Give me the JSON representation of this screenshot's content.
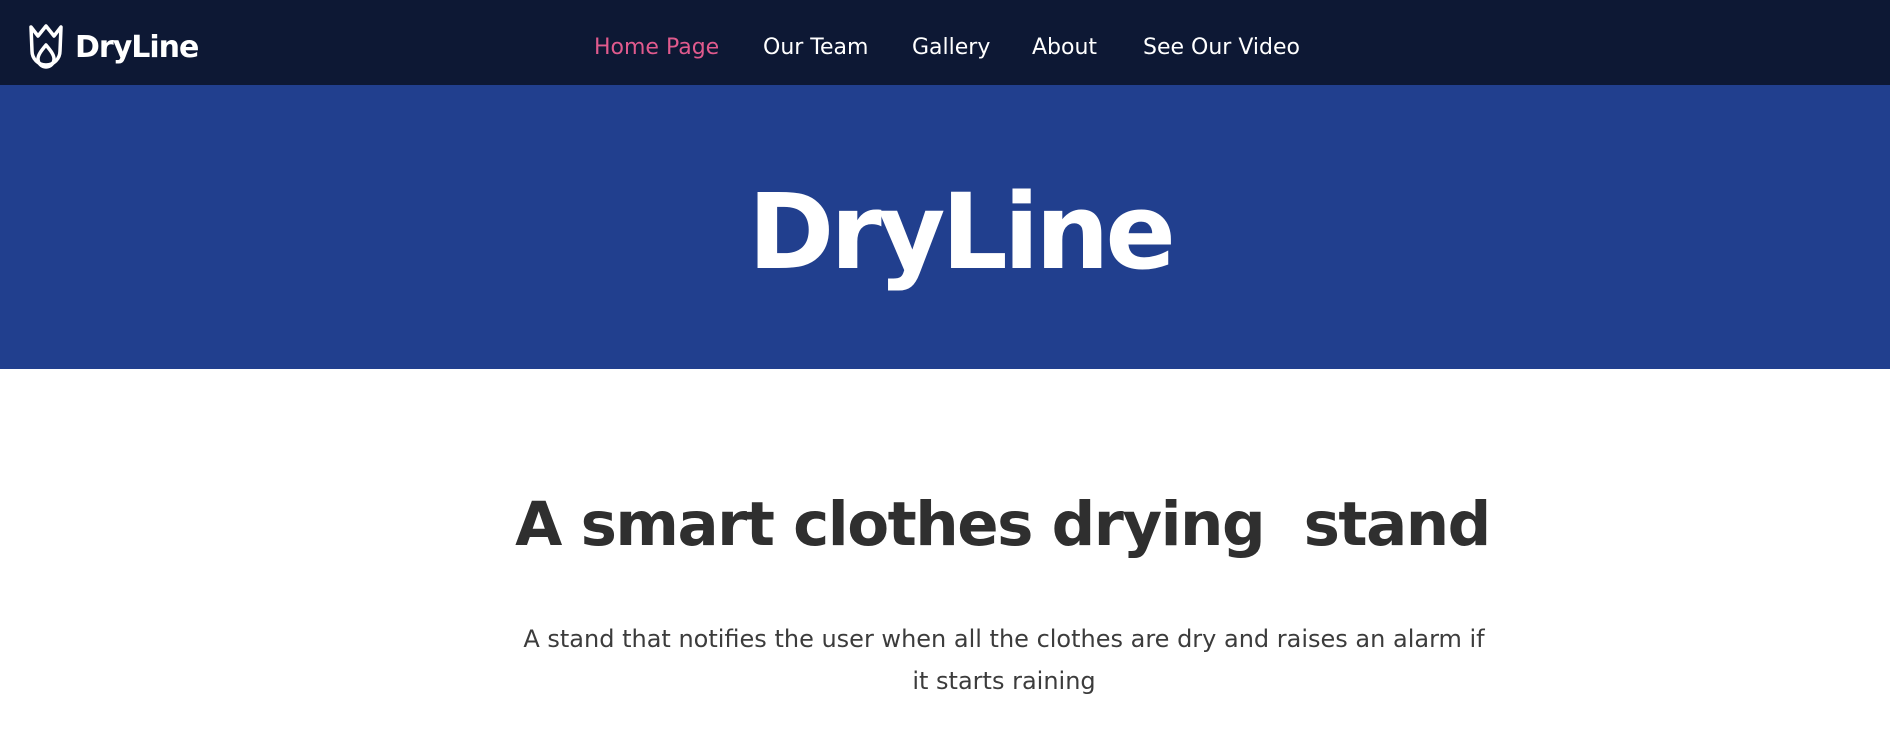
{
  "header": {
    "logo_text": "DryLine",
    "logo_icon": "crown-drop-icon",
    "nav": [
      {
        "label": "Home Page",
        "active": true
      },
      {
        "label": "Our Team",
        "active": false
      },
      {
        "label": "Gallery",
        "active": false
      },
      {
        "label": "About",
        "active": false
      },
      {
        "label": "See Our Video",
        "active": false
      }
    ]
  },
  "hero": {
    "title": "DryLine"
  },
  "main": {
    "heading": "A smart clothes drying  stand",
    "description": "A stand that notifies the user when all the clothes are dry and raises an alarm if it starts raining"
  },
  "colors": {
    "navbar_bg": "#0d1834",
    "hero_bg": "#213f8e",
    "active_link": "#e05a8d",
    "heading_text": "#2f2f2f"
  }
}
